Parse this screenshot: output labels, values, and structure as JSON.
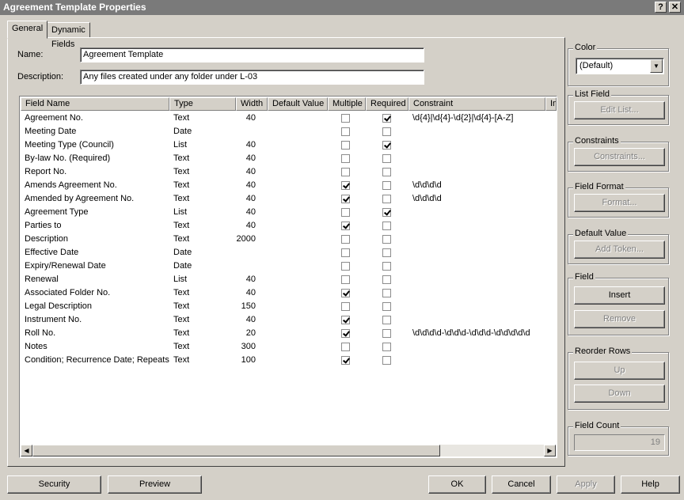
{
  "window": {
    "title": "Agreement Template Properties",
    "help_btn": "?",
    "close_btn": "✕"
  },
  "tabs": [
    {
      "label": "General",
      "active": true
    },
    {
      "label": "Dynamic Fields",
      "active": false
    }
  ],
  "form": {
    "name_label": "Name:",
    "name_value": "Agreement Template",
    "description_label": "Description:",
    "description_value": "Any files created under any folder under L-03"
  },
  "grid": {
    "headers": [
      "Field Name",
      "Type",
      "Width",
      "Default Value",
      "Multiple",
      "Required",
      "Constraint",
      "In"
    ],
    "rows": [
      {
        "name": "Agreement No.",
        "type": "Text",
        "width": "40",
        "multiple": false,
        "required": true,
        "constraint": "\\d{4}|\\d{4}-\\d{2}|\\d{4}-[A-Z]"
      },
      {
        "name": "Meeting Date",
        "type": "Date",
        "width": "",
        "multiple": false,
        "required": false,
        "constraint": ""
      },
      {
        "name": "Meeting Type (Council)",
        "type": "List",
        "width": "40",
        "multiple": false,
        "required": true,
        "constraint": ""
      },
      {
        "name": "By-law No. (Required)",
        "type": "Text",
        "width": "40",
        "multiple": false,
        "required": false,
        "constraint": ""
      },
      {
        "name": "Report No.",
        "type": "Text",
        "width": "40",
        "multiple": false,
        "required": false,
        "constraint": ""
      },
      {
        "name": "Amends Agreement No.",
        "type": "Text",
        "width": "40",
        "multiple": true,
        "required": false,
        "constraint": "\\d\\d\\d\\d"
      },
      {
        "name": "Amended by Agreement No.",
        "type": "Text",
        "width": "40",
        "multiple": true,
        "required": false,
        "constraint": "\\d\\d\\d\\d"
      },
      {
        "name": "Agreement Type",
        "type": "List",
        "width": "40",
        "multiple": false,
        "required": true,
        "constraint": ""
      },
      {
        "name": "Parties to",
        "type": "Text",
        "width": "40",
        "multiple": true,
        "required": false,
        "constraint": ""
      },
      {
        "name": "Description",
        "type": "Text",
        "width": "2000",
        "multiple": false,
        "required": false,
        "constraint": ""
      },
      {
        "name": "Effective Date",
        "type": "Date",
        "width": "",
        "multiple": false,
        "required": false,
        "constraint": ""
      },
      {
        "name": "Expiry/Renewal Date",
        "type": "Date",
        "width": "",
        "multiple": false,
        "required": false,
        "constraint": ""
      },
      {
        "name": "Renewal",
        "type": "List",
        "width": "40",
        "multiple": false,
        "required": false,
        "constraint": ""
      },
      {
        "name": "Associated Folder No.",
        "type": "Text",
        "width": "40",
        "multiple": true,
        "required": false,
        "constraint": ""
      },
      {
        "name": "Legal Description",
        "type": "Text",
        "width": "150",
        "multiple": false,
        "required": false,
        "constraint": ""
      },
      {
        "name": "Instrument No.",
        "type": "Text",
        "width": "40",
        "multiple": true,
        "required": false,
        "constraint": ""
      },
      {
        "name": "Roll No.",
        "type": "Text",
        "width": "20",
        "multiple": true,
        "required": false,
        "constraint": "\\d\\d\\d\\d-\\d\\d\\d-\\d\\d\\d-\\d\\d\\d\\d\\d"
      },
      {
        "name": "Notes",
        "type": "Text",
        "width": "300",
        "multiple": false,
        "required": false,
        "constraint": ""
      },
      {
        "name": "Condition; Recurrence Date; Repeats",
        "type": "Text",
        "width": "100",
        "multiple": true,
        "required": false,
        "constraint": ""
      }
    ]
  },
  "side": {
    "color_title": "Color",
    "color_value": "(Default)",
    "list_field_title": "List Field",
    "edit_list": "Edit List...",
    "constraints_title": "Constraints",
    "constraints_btn": "Constraints...",
    "field_format_title": "Field Format",
    "format_btn": "Format...",
    "default_value_title": "Default Value",
    "add_token_btn": "Add Token...",
    "field_title": "Field",
    "insert_btn": "Insert",
    "remove_btn": "Remove",
    "reorder_title": "Reorder Rows",
    "up_btn": "Up",
    "down_btn": "Down",
    "field_count_title": "Field Count",
    "field_count_value": "19"
  },
  "footer": {
    "security": "Security",
    "preview": "Preview",
    "ok": "OK",
    "cancel": "Cancel",
    "apply": "Apply",
    "help": "Help"
  }
}
